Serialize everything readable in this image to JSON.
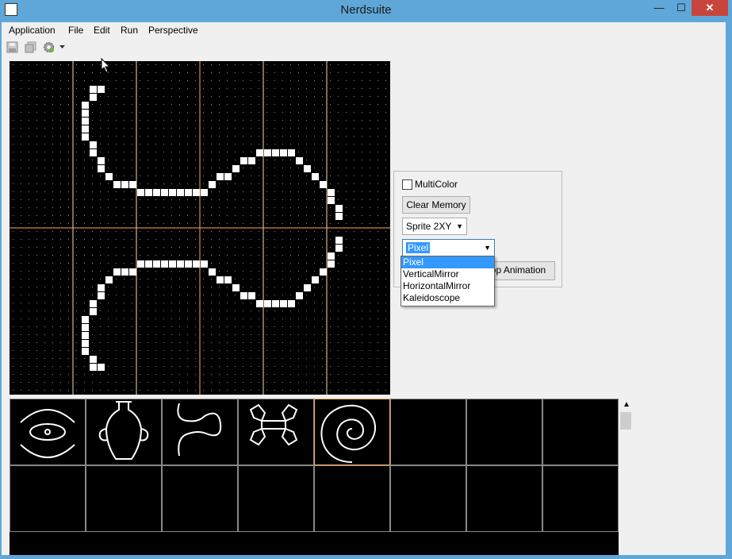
{
  "window": {
    "title": "Nerdsuite",
    "minimize_glyph": "—",
    "maximize_glyph": "☐",
    "close_glyph": "✕"
  },
  "menubar": {
    "items": [
      "Application",
      "File",
      "Edit",
      "Run",
      "Perspective"
    ]
  },
  "toolbar": {
    "icons": [
      "save-icon",
      "save-all-icon",
      "run-gear-icon",
      "dropdown-arrow-icon"
    ]
  },
  "panel": {
    "multicolor_label": "MultiColor",
    "multicolor_checked": false,
    "clear_memory_label": "Clear Memory",
    "sprite_size_value": "Sprite 2XY",
    "mode_value": "Pixel",
    "animation_button_visible_text": "op Animation"
  },
  "mode_dropdown": {
    "options": [
      "Pixel",
      "VerticalMirror",
      "HorizontalMirror",
      "Kaleidoscope"
    ],
    "selected_index": 0
  },
  "sprites": {
    "count_visible": 16,
    "selected_index": 4
  },
  "colors": {
    "titlebar": "#5ea7d8",
    "close": "#c7453b",
    "grid_line": "#f0e0a8",
    "center_line": "#ffaa55",
    "selection": "#3399ff"
  }
}
